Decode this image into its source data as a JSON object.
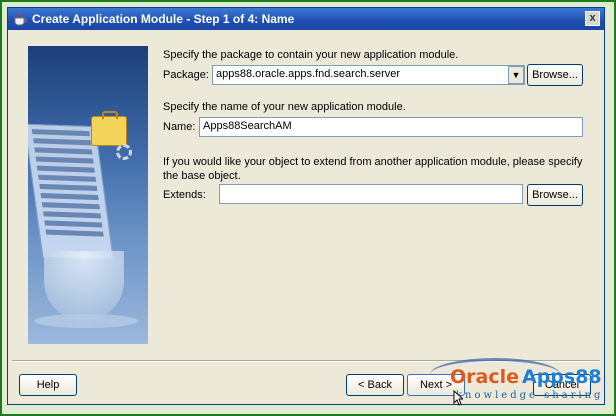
{
  "window": {
    "title": "Create Application Module - Step 1 of 4: Name",
    "close_glyph": "x"
  },
  "package_section": {
    "prompt": "Specify the package to contain your new application module.",
    "label": "Package:",
    "value": "apps88.oracle.apps.fnd.search.server",
    "browse_label": "Browse..."
  },
  "name_section": {
    "prompt": "Specify the name of your new application module.",
    "label": "Name:",
    "value": "Apps88SearchAM"
  },
  "extends_section": {
    "prompt_line1": "If you would like your object to extend from another application module, please specify",
    "prompt_line2": "the base object.",
    "label": "Extends:",
    "value": "",
    "browse_label": "Browse..."
  },
  "footer": {
    "help_label": "Help",
    "back_label": "< Back",
    "next_label": "Next >",
    "cancel_label": "Cancel"
  },
  "watermark": {
    "oracle": "Oracle",
    "apps88": "Apps88",
    "tagline": "knowledge sharing"
  },
  "colors": {
    "titlebar": "#1f4fb0",
    "frame": "#1e7a1e",
    "dialog_bg": "#ece9d8",
    "watermark_orange": "#e2571d",
    "watermark_blue": "#1f7ed6"
  }
}
